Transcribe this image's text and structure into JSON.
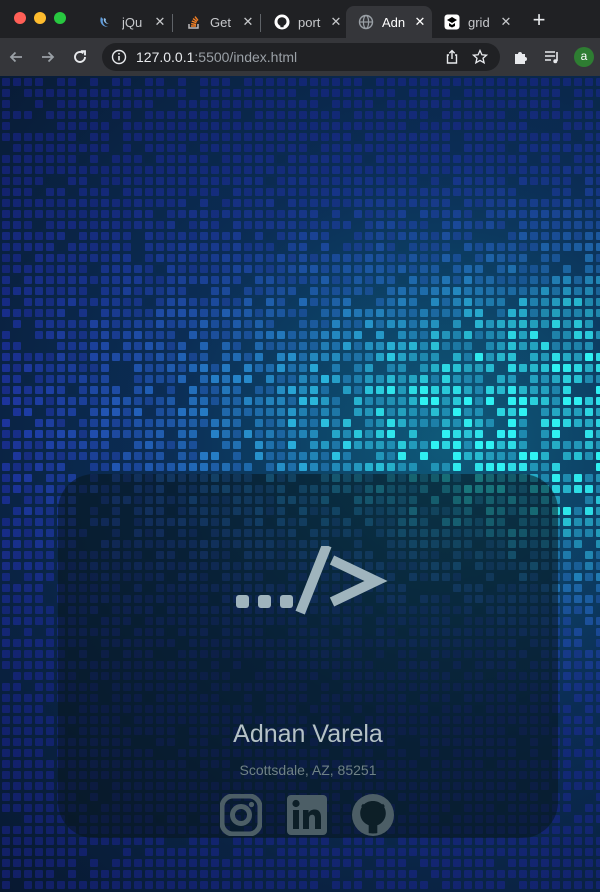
{
  "browser": {
    "tabs": [
      {
        "title": "jQu",
        "icon": "jquery-icon"
      },
      {
        "title": "Get",
        "icon": "stackoverflow-icon"
      },
      {
        "title": "port",
        "icon": "github-icon"
      },
      {
        "title": "Adn",
        "icon": "globe-icon",
        "active": true
      },
      {
        "title": "grid",
        "icon": "codepen-icon"
      }
    ],
    "url_host": "127.0.0.1",
    "url_rest": ":5500/index.html",
    "profile_initial": "a"
  },
  "card": {
    "logo_text": "..../>",
    "name": "Adnan Varela",
    "location": "Scottsdale, AZ, 85251",
    "socials": [
      {
        "icon": "instagram-icon"
      },
      {
        "icon": "linkedin-icon"
      },
      {
        "icon": "github-icon"
      }
    ]
  },
  "colors": {
    "accent_cyan": "#3fe0f0",
    "accent_blue": "#2f6fe0",
    "page_dark": "#081830"
  }
}
